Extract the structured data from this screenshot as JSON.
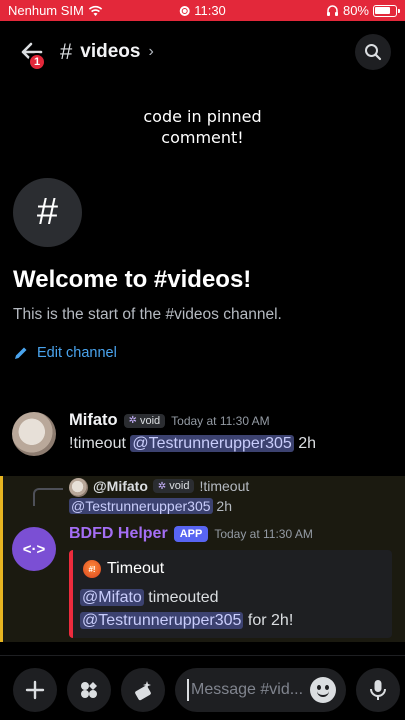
{
  "status": {
    "carrier": "Nenhum SIM",
    "time": "11:30",
    "battery": "80%"
  },
  "header": {
    "badge": "1",
    "channel": "videos"
  },
  "note": {
    "line1": "code in pinned",
    "line2": "comment!"
  },
  "welcome": {
    "title": "Welcome to #videos!",
    "subtitle": "This is the start of the #videos channel.",
    "edit_label": "Edit channel"
  },
  "messages": [
    {
      "author": "Mifato",
      "tag": "void",
      "timestamp": "Today at 11:30 AM",
      "text_prefix": "!timeout",
      "mention": "@Testrunnerupper305",
      "text_suffix": "2h"
    },
    {
      "reply": {
        "author": "@Mifato",
        "tag": "void",
        "text": "!timeout",
        "mention": "@Testrunnerupper305",
        "suffix": "2h"
      },
      "author": "BDFD Helper",
      "app_tag": "APP",
      "timestamp": "Today at 11:30 AM",
      "embed": {
        "title": "Timeout",
        "mention1": "@Mifato",
        "text1": "timeouted",
        "mention2": "@Testrunnerupper305",
        "text2": "for 2h!"
      }
    }
  ],
  "composer": {
    "placeholder": "Message #vid..."
  },
  "colors": {
    "status_bar": "#e3283a",
    "accent_link": "#4aa4ee",
    "bot_name": "#a46ef4",
    "app_tag": "#5865f2",
    "embed_bar": "#ed2b3d",
    "highlight_bar": "#e6b421"
  }
}
